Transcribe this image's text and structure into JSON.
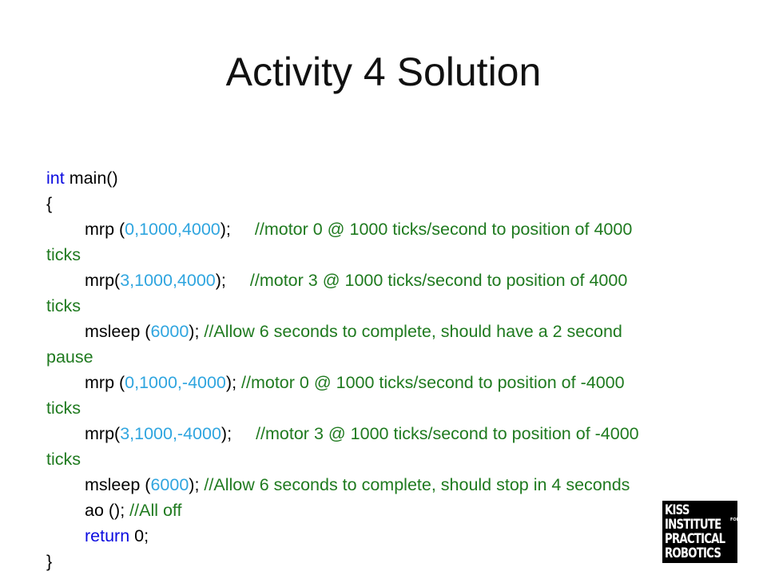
{
  "slide": {
    "title": "Activity 4 Solution"
  },
  "code": {
    "l1_kw": "int",
    "l1_rest": " main()",
    "l2": "{",
    "l3_a": "mrp (",
    "l3_num": "0,1000,4000",
    "l3_b": ");",
    "l3_cmt": "//motor 0 @ 1000 ticks/second to position of 4000",
    "l4_cmt": "ticks",
    "l5_a": "mrp(",
    "l5_num": "3,1000,4000",
    "l5_b": ");",
    "l5_cmt": "//motor 3 @ 1000 ticks/second to position of 4000",
    "l6_cmt": "ticks",
    "l7_a": "msleep (",
    "l7_num": "6000",
    "l7_b": "); ",
    "l7_cmt": "//Allow 6 seconds to complete, should have a 2 second",
    "l8_cmt": "pause",
    "l9_a": "mrp (",
    "l9_num": "0,1000,-4000",
    "l9_b": "); ",
    "l9_cmt": "//motor 0 @ 1000 ticks/second to position of -4000",
    "l10_cmt": "ticks",
    "l11_a": "mrp(",
    "l11_num": "3,1000,-4000",
    "l11_b": ");",
    "l11_cmt": "//motor 3 @ 1000 ticks/second to position of -4000",
    "l12_cmt": "ticks",
    "l13_a": "msleep (",
    "l13_num": "6000",
    "l13_b": "); ",
    "l13_cmt": "//Allow 6 seconds to complete, should stop in 4 seconds",
    "l14_a": "ao (); ",
    "l14_cmt": "//All off",
    "l15_kw": "return",
    "l15_rest": " 0;",
    "l16": "}"
  },
  "colors": {
    "keyword": "#0c0ce0",
    "number": "#2fa5df",
    "comment": "#1f7a1f"
  },
  "logo": {
    "line1": "KISS",
    "line2": "INSTITUTE",
    "for": "FOR",
    "line3": "PRACTICAL",
    "line4": "ROBOTICS"
  }
}
